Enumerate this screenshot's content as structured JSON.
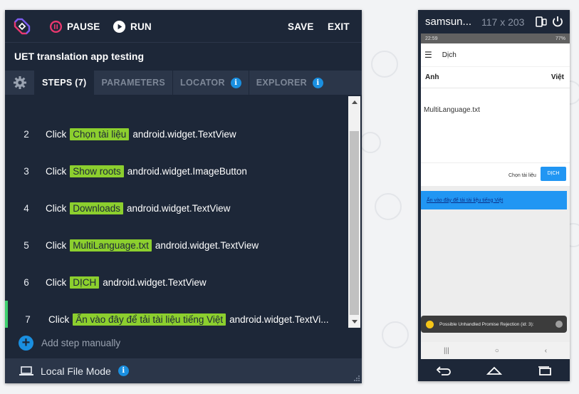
{
  "toolbar": {
    "pause_label": "PAUSE",
    "run_label": "RUN",
    "save_label": "SAVE",
    "exit_label": "EXIT"
  },
  "app_title": "UET translation app testing",
  "tabs": [
    {
      "label": "STEPS (7)",
      "active": true
    },
    {
      "label": "PARAMETERS",
      "active": false
    },
    {
      "label": "LOCATOR",
      "active": false,
      "info": true
    },
    {
      "label": "EXPLORER",
      "active": false,
      "info": true
    }
  ],
  "steps": [
    {
      "num": "2",
      "action": "Click",
      "target": "Chọn tài liệu",
      "class": "android.widget.TextView"
    },
    {
      "num": "3",
      "action": "Click",
      "target": "Show roots",
      "class": "android.widget.ImageButton"
    },
    {
      "num": "4",
      "action": "Click",
      "target": "Downloads",
      "class": "android.widget.TextView"
    },
    {
      "num": "5",
      "action": "Click",
      "target": "MultiLanguage.txt",
      "class": "android.widget.TextView"
    },
    {
      "num": "6",
      "action": "Click",
      "target": "DỊCH",
      "class": "android.widget.TextView"
    },
    {
      "num": "7",
      "action": "Click",
      "target": "Ấn vào đây để tải tài liệu tiếng Việt",
      "class": "android.widget.TextVi..."
    }
  ],
  "current_step": "7",
  "add_step_label": "Add step manually",
  "footer": {
    "mode_label": "Local File Mode"
  },
  "device": {
    "name": "samsun...",
    "size": "117 x 203",
    "status_time": "22:59",
    "status_battery": "77%",
    "app_bar_title": "Dịch",
    "source_lang": "Anh",
    "target_lang": "Việt",
    "input_text": "MultiLanguage.txt",
    "choose_doc_label": "Chọn tài liệu",
    "translate_button": "DỊCH",
    "download_link": "Ấn vào đây để tải tài liệu tiếng Việt",
    "toast_text": "Possible Unhandled Promise Rejection (id: 3):"
  },
  "colors": {
    "panel_bg": "#1d2738",
    "tab_bg": "#2b3649",
    "highlight": "#8ccf2e",
    "accent_blue": "#1a8fe0",
    "current_step_marker": "#3ecf6e"
  }
}
